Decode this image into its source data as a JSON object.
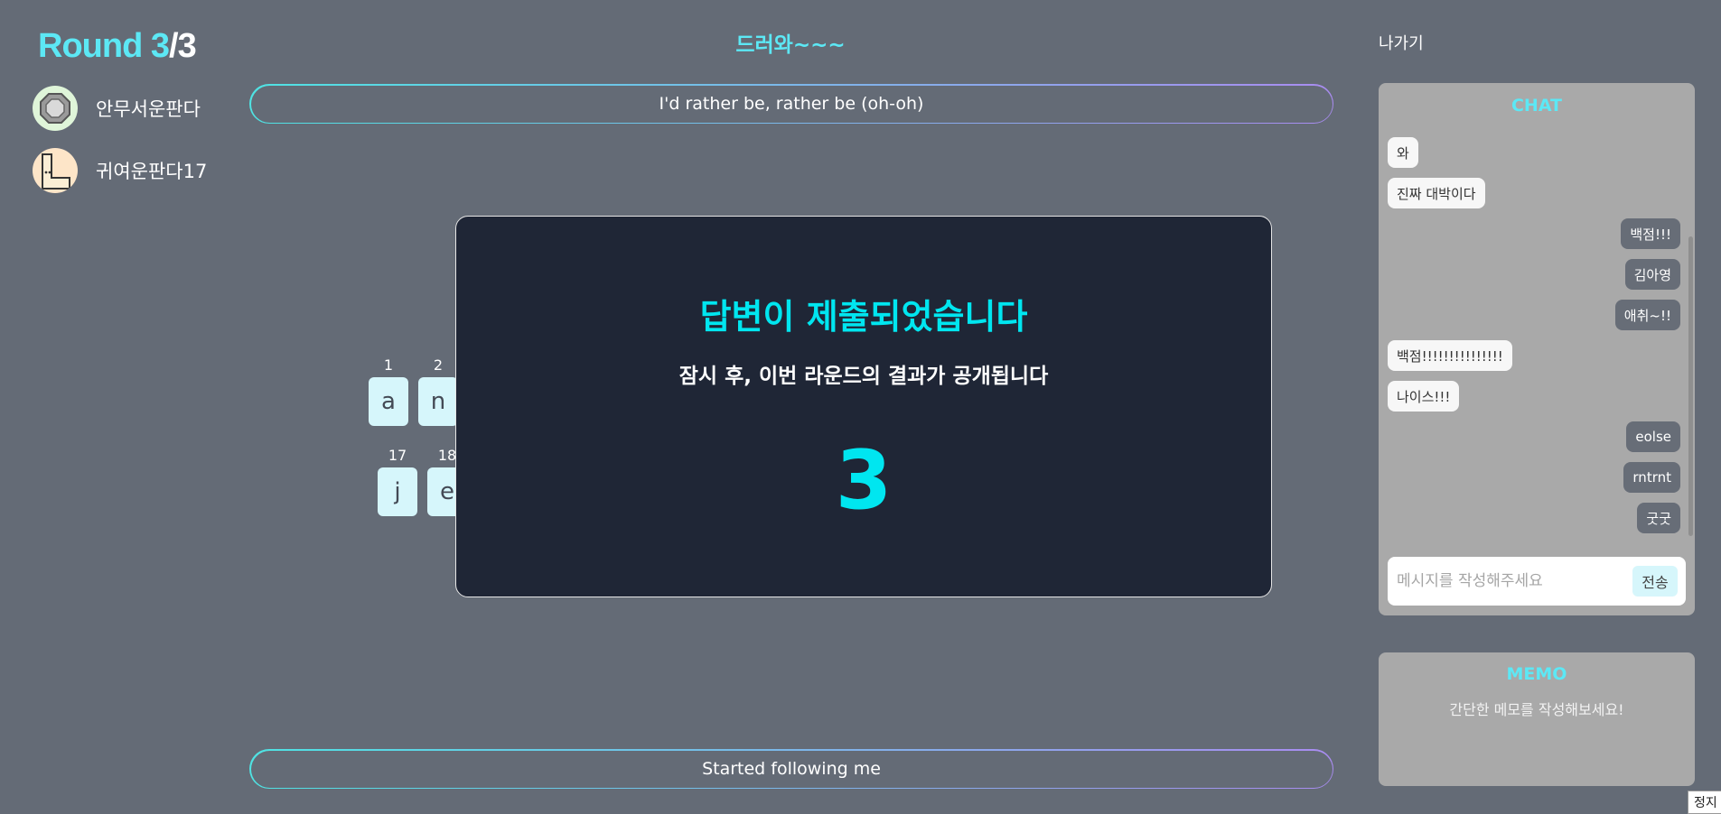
{
  "round": {
    "label": "Round",
    "current": "3",
    "sep": "/",
    "total": "3"
  },
  "players": [
    {
      "name": "안무서운판다",
      "avatar_bg": "#dff5d9"
    },
    {
      "name": "귀여운판다17",
      "avatar_bg": "#fde5c8"
    }
  ],
  "topic": "드러와~~~",
  "lyric_top": "I'd rather be, rather be (oh-oh)",
  "lyric_bottom": "Started following me",
  "tiles": {
    "row1": [
      {
        "num": "1",
        "letter": "a"
      },
      {
        "num": "2",
        "letter": "n"
      }
    ],
    "row2": [
      {
        "num": "17",
        "letter": "j"
      },
      {
        "num": "18",
        "letter": "e"
      }
    ]
  },
  "modal": {
    "title": "답변이 제출되었습니다",
    "subtitle": "잠시 후, 이번 라운드의 결과가 공개됩니다",
    "countdown": "3"
  },
  "exit_label": "나가기",
  "chat": {
    "title": "CHAT",
    "messages": [
      {
        "text": "와",
        "side": "in"
      },
      {
        "text": "진짜 대박이다",
        "side": "in"
      },
      {
        "text": "백점!!!",
        "side": "out"
      },
      {
        "text": "김아영",
        "side": "out"
      },
      {
        "text": "애취~!!",
        "side": "out"
      },
      {
        "text": "백점!!!!!!!!!!!!!!!",
        "side": "in"
      },
      {
        "text": "나이스!!!",
        "side": "in"
      },
      {
        "text": "eolse",
        "side": "out"
      },
      {
        "text": "rntrnt",
        "side": "out"
      },
      {
        "text": "굿굿",
        "side": "out"
      }
    ],
    "input_placeholder": "메시지를 작성해주세요",
    "send_label": "전송"
  },
  "memo": {
    "title": "MEMO",
    "placeholder": "간단한 메모를 작성해보세요!"
  },
  "stop_label": "정지",
  "colors": {
    "accent": "#5ce8f5",
    "background": "#646b76",
    "modal_bg": "#1f2636",
    "tile_bg": "#d6f6fb"
  }
}
